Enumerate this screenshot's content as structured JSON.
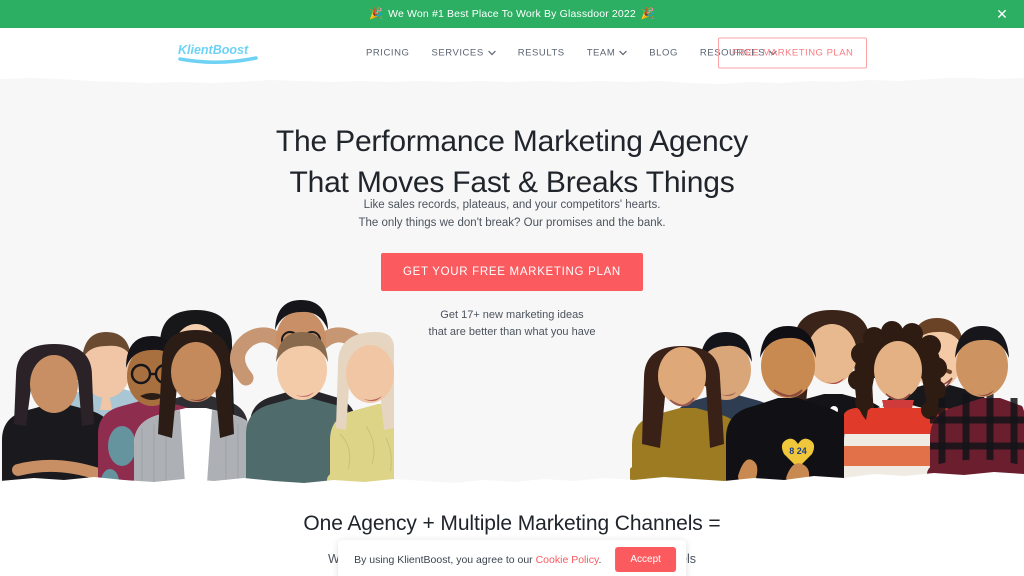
{
  "announcement": {
    "emoji_left": "🎉",
    "emoji_right": "🎉",
    "text": "We Won #1 Best Place To Work By Glassdoor 2022",
    "close_label": "✕",
    "background_color": "#2CAF63"
  },
  "header": {
    "logo_text": "KlientBoost",
    "logo_color": "#6FD2F5",
    "nav": [
      {
        "label": "PRICING",
        "has_dropdown": false
      },
      {
        "label": "SERVICES",
        "has_dropdown": true
      },
      {
        "label": "RESULTS",
        "has_dropdown": false
      },
      {
        "label": "TEAM",
        "has_dropdown": true
      },
      {
        "label": "BLOG",
        "has_dropdown": false
      },
      {
        "label": "RESOURCES",
        "has_dropdown": true
      }
    ],
    "cta_label": "FREE MARKETING PLAN",
    "cta_color": "#FB7B80"
  },
  "hero": {
    "title_line1": "The Performance Marketing Agency",
    "title_line2": "That Moves Fast & Breaks Things",
    "sub_line1": "Like sales records, plateaus, and your competitors' hearts.",
    "sub_line2": "The only things we don't break? Our promises and the bank.",
    "cta_label": "GET YOUR FREE MARKETING PLAN",
    "cta_color": "#FB5A5F",
    "cta_note_line1": "Get 17+ new marketing ideas",
    "cta_note_line2": "that are better than what you have",
    "background_color": "#F7F7F7"
  },
  "section2": {
    "title": "One Agency + Multiple Marketing Channels =",
    "subtitle": "We help companies scale their strategies across multiple channels"
  },
  "cookie": {
    "text_before": "By using KlientBoost, you agree to our ",
    "link_label": "Cookie Policy",
    "text_after": ".",
    "accept_label": "Accept",
    "accent_color": "#FB5A5F"
  }
}
